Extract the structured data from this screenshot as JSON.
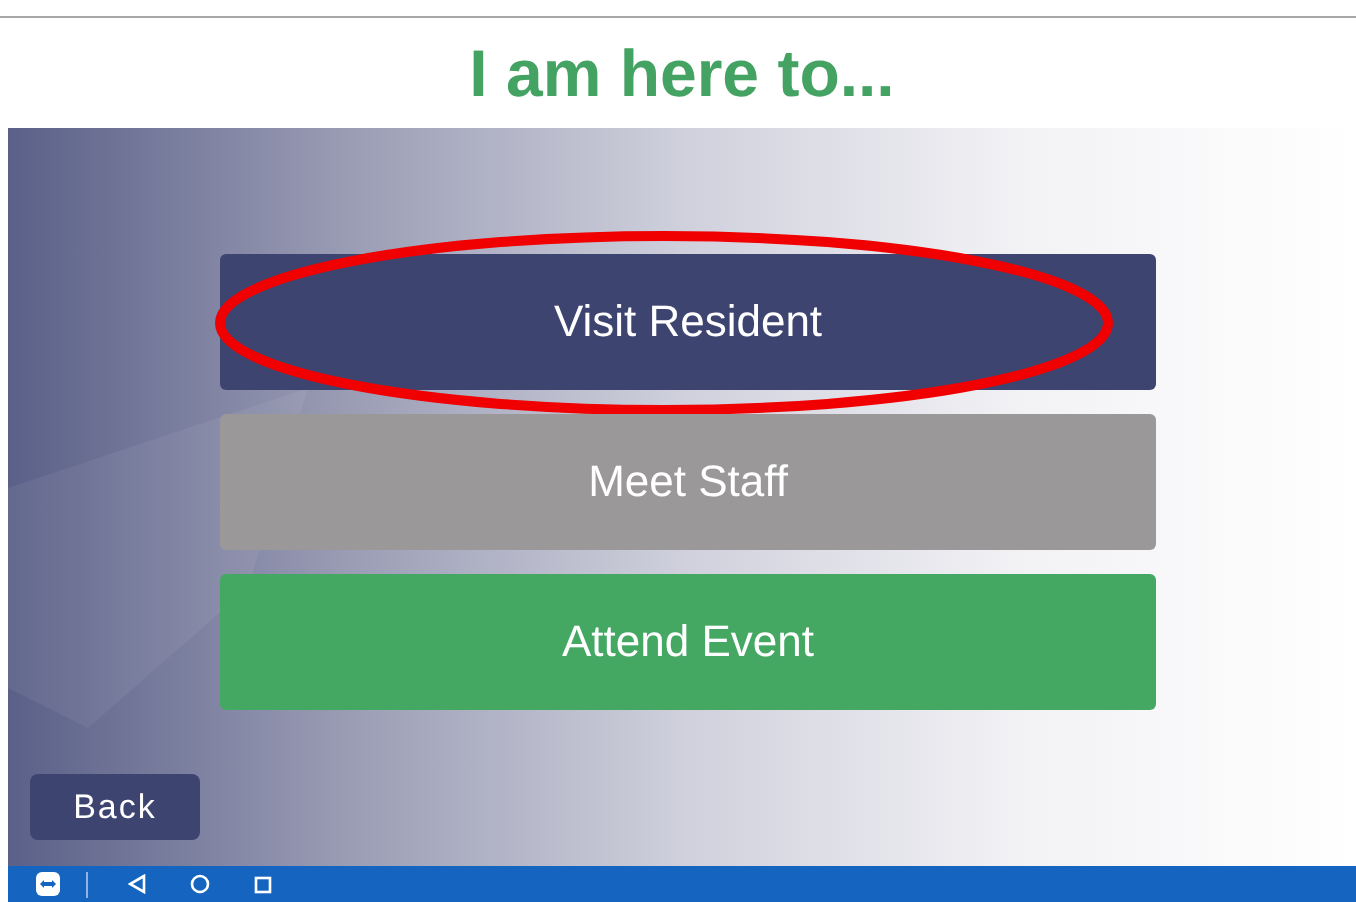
{
  "title": "I am here to...",
  "options": [
    {
      "label": "Visit Resident",
      "color": "#3d4470",
      "circled": true
    },
    {
      "label": "Meet Staff",
      "color": "#9a9899",
      "circled": false
    },
    {
      "label": "Attend Event",
      "color": "#44a862",
      "circled": false
    }
  ],
  "back_button": "Back"
}
